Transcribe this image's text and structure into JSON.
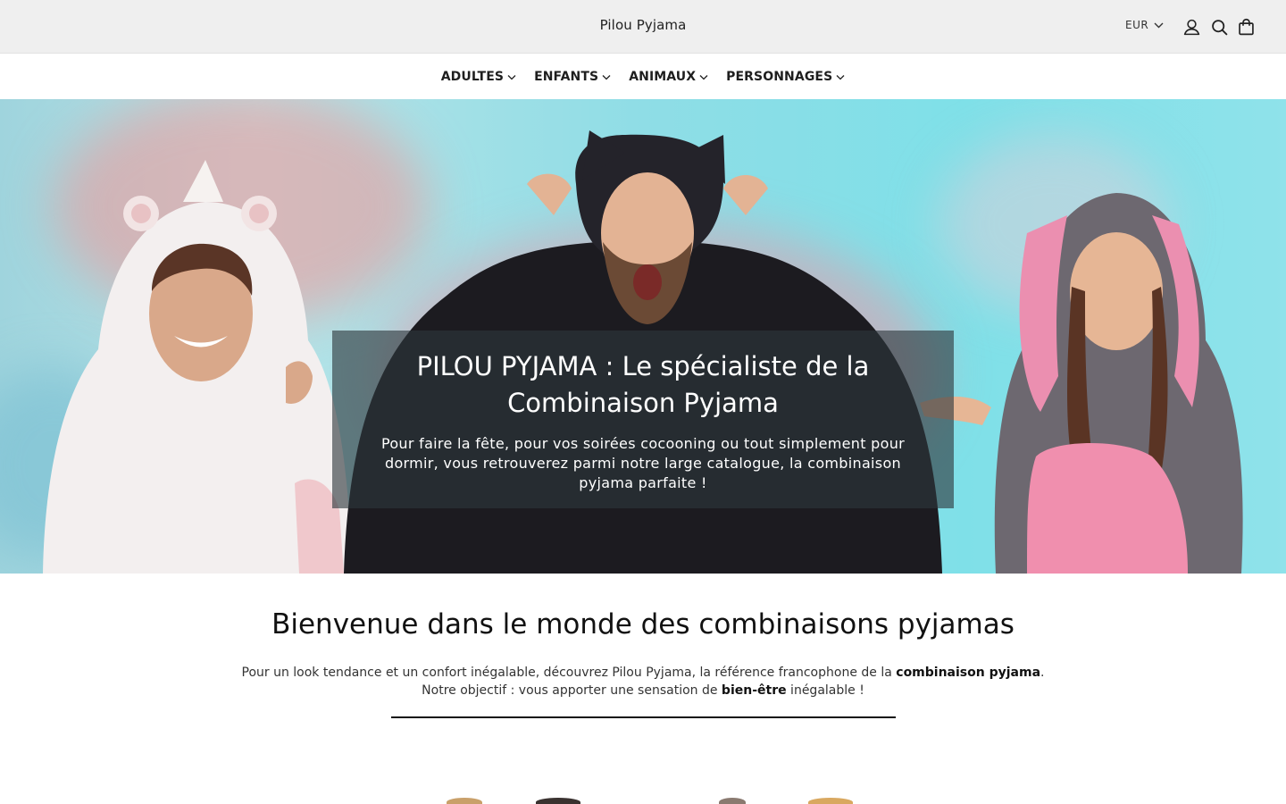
{
  "header": {
    "brand": "Pilou Pyjama",
    "currency": "EUR",
    "icons": [
      "account-icon",
      "search-icon",
      "cart-icon"
    ]
  },
  "nav": {
    "items": [
      {
        "label": "ADULTES"
      },
      {
        "label": "ENFANTS"
      },
      {
        "label": "ANIMAUX"
      },
      {
        "label": "PERSONNAGES"
      }
    ]
  },
  "hero": {
    "title": "PILOU PYJAMA : Le spécialiste de la Combinaison Pyjama",
    "text": "Pour faire la fête, pour vos soirées cocooning ou tout simplement pour dormir, vous retrouverez parmi notre large catalogue, la combinaison pyjama parfaite !"
  },
  "welcome": {
    "title": "Bienvenue dans le monde des combinaisons pyjamas",
    "line1_prefix": "Pour un look tendance et un confort inégalable, découvrez Pilou Pyjama, la référence francophone de la ",
    "line1_bold": "combinaison pyjama",
    "line1_suffix": ".",
    "line2_prefix": "Notre objectif : vous apporter une sensation de ",
    "line2_bold": "bien-être",
    "line2_suffix": " inégalable !"
  },
  "colors": {
    "topbar_bg": "#efefef",
    "hero_overlay": "#2d373c",
    "text": "#111111"
  }
}
